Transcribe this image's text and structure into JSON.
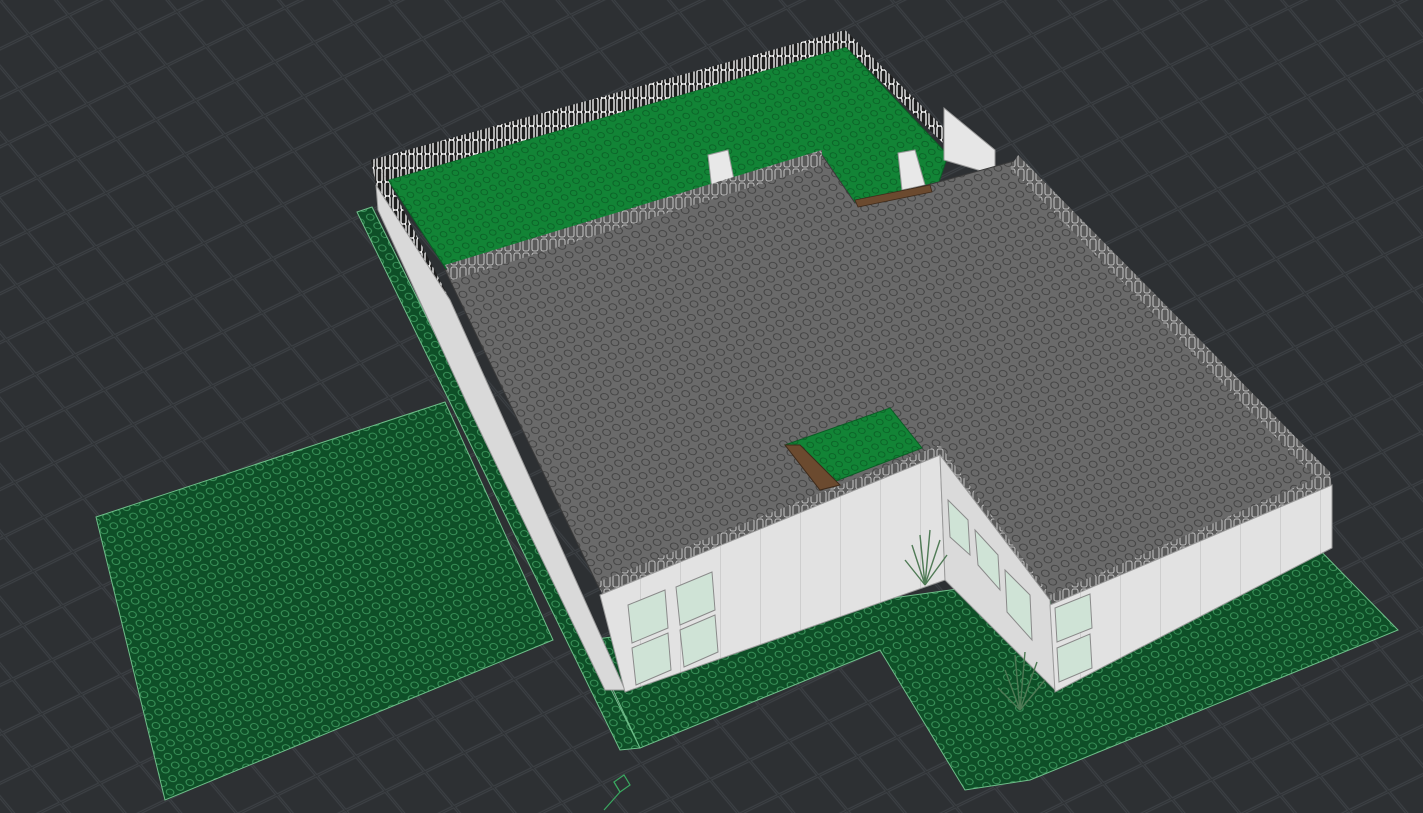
{
  "viewport": {
    "background": "#2d3033",
    "grid_color": "#3b3f43",
    "camera": "isometric-perspective"
  },
  "scene": {
    "baseplate_color": "#0f5a2c",
    "baseplate_stud_color": "#2e7d4a",
    "roof_color": "#6e6e6e",
    "roof_stud_color": "#8a8a8a",
    "wall_color": "#e3e3e3",
    "rooftop_garden_color": "#138a3a",
    "railing_color": "#ffffff",
    "window_color": "#cfe3d6",
    "plank_color": "#6b4a2f",
    "plant_color": "#4f7a55"
  },
  "gizmo": {
    "icon": "camera-target-icon",
    "color": "#3aa860"
  }
}
